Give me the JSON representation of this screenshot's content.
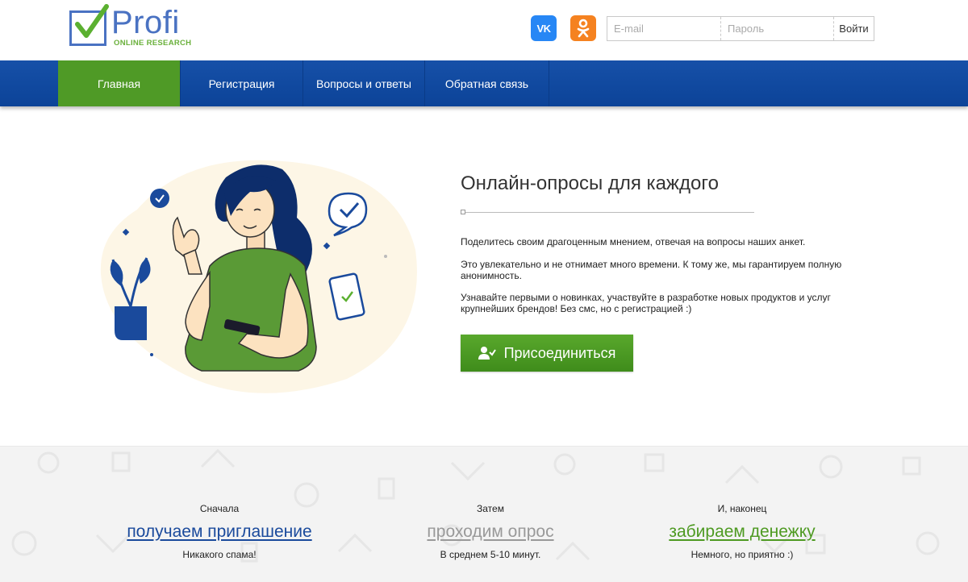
{
  "header": {
    "logo_word": "Profi",
    "logo_sub": "ONLINE RESEARCH",
    "social": [
      {
        "name": "vk",
        "label": "VK",
        "color": "#2787f5"
      },
      {
        "name": "ok",
        "color": "#f58220"
      }
    ],
    "login": {
      "email_placeholder": "E-mail",
      "password_placeholder": "Пароль",
      "submit_label": "Войти"
    }
  },
  "nav": {
    "items": [
      {
        "label": "Главная",
        "active": true
      },
      {
        "label": "Регистрация"
      },
      {
        "label": "Вопросы и ответы"
      },
      {
        "label": "Обратная связь"
      }
    ]
  },
  "hero": {
    "title": "Онлайн-опросы для каждого",
    "paragraphs": [
      "Поделитесь своим драгоценным мнением, отвечая на вопросы наших анкет.",
      "Это увлекательно и не отнимает много времени. К тому же, мы гарантируем полную анонимность.",
      "Узнавайте первыми о новинках, участвуйте в разработке новых продуктов и услуг крупнейших брендов! Без смс, но с регистрацией :)"
    ],
    "join_label": "Присоединиться",
    "join_icon": "user-check-icon"
  },
  "steps": [
    {
      "pre": "Сначала",
      "main": "получаем приглашение",
      "post": "Никакого спама!"
    },
    {
      "pre": "Затем",
      "main": "проходим опрос",
      "post": "В среднем 5-10 минут."
    },
    {
      "pre": "И, наконец",
      "main": "забираем денежку",
      "post": "Немного, но приятно :)"
    }
  ],
  "colors": {
    "brand_blue": "#0c4398",
    "brand_green": "#4f9a26",
    "logo_blue": "#4a72c2"
  }
}
